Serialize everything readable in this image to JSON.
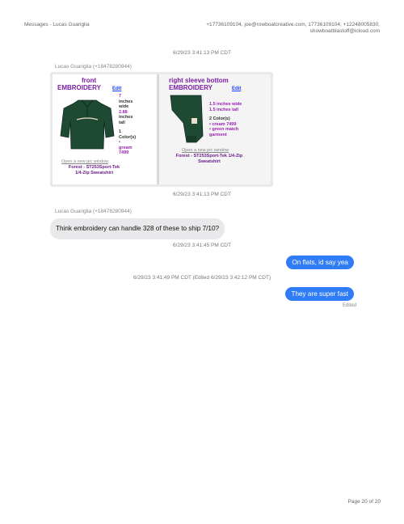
{
  "header": {
    "title": "Messages - Lucas Guariglia",
    "participants": "+17736109104, joe@rowboatcreative.com, 17736109104, +12248005830, showboatblastoff@icloud.com"
  },
  "messages": {
    "ts1": "6/29/23 3:41:13 PM CDT",
    "sender1": "Lucas Guariglia (+18478280944)",
    "ts2": "6/29/23 3:41:13 PM CDT",
    "sender2": "Lucas Guariglia (+18478280944)",
    "incoming_text": "Think embroidery can handle 328 of these to ship 7/10?",
    "ts3": "6/29/23 3:41:45 PM CDT",
    "outgoing1": "On flats, id say yea",
    "ts4": "6/29/23 3:41:49 PM CDT (Edited 6/29/23 3:42:12 PM CDT)",
    "outgoing2": "They are super fast",
    "edited_label": "Edited"
  },
  "attachment": {
    "left": {
      "title1": "front",
      "title2": "EMBROIDERY",
      "edit": "Edit",
      "spec1": "7",
      "spec2": "inches",
      "spec3": "wide",
      "spec4": "2.88",
      "spec5": "inches",
      "spec6": "tall",
      "spec7": "1",
      "spec8": "Color(s)",
      "spec9": "•",
      "spec10": "gream",
      "spec11": "7499",
      "link": "Open a new pic window",
      "desc1": "Forest - ST253Sport-Tek",
      "desc2": "1/4-Zip Sweatshirt"
    },
    "right": {
      "title1": "right sleeve bottom",
      "title2": "EMBROIDERY",
      "edit": "Edit",
      "spec1": "1.5 inches wide",
      "spec2": "1.5 inches tall",
      "spec3": "2 Color(s)",
      "spec4": "• cream 7499",
      "spec5": "• green match",
      "spec6": "garment",
      "link": "Open a new pic window",
      "desc1": "Forest - ST253Sport-Tek 1/4-Zip",
      "desc2": "Sweatshirt"
    }
  },
  "footer": {
    "page": "Page 20 of 20"
  }
}
